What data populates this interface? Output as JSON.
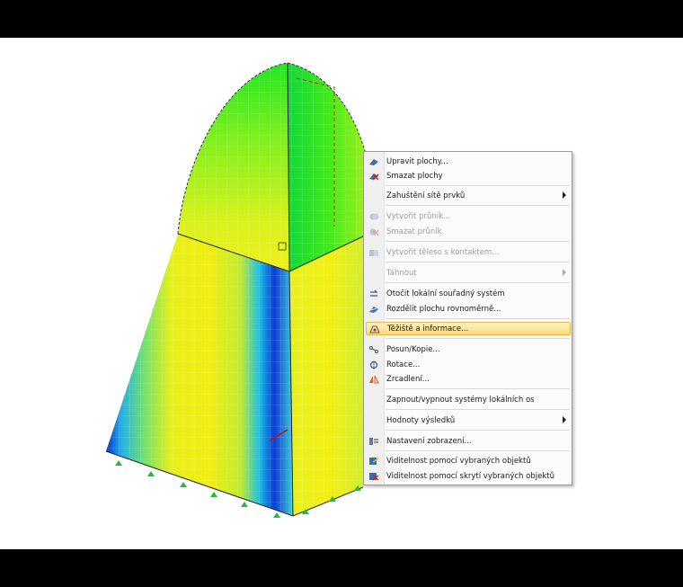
{
  "menu": {
    "items": [
      {
        "label": "Upravit plochy...",
        "icon": "edit-surface-icon"
      },
      {
        "label": "Smazat plochy",
        "icon": "delete-surface-icon"
      },
      {
        "label": "Zahuštění sítě prvků",
        "icon": "",
        "submenu": true
      },
      {
        "label": "Vytvořit průnik...",
        "icon": "intersection-icon",
        "disabled": true
      },
      {
        "label": "Smazat průnik",
        "icon": "delete-intersection-icon",
        "disabled": true
      },
      {
        "label": "Vytvořit těleso s kontaktem...",
        "icon": "solid-contact-icon",
        "disabled": true
      },
      {
        "label": "Táhnout",
        "icon": "",
        "submenu": true,
        "disabled": true
      },
      {
        "label": "Otočit lokální souřadný systém",
        "icon": "rotate-axes-icon"
      },
      {
        "label": "Rozdělit plochu rovnoměrně...",
        "icon": "divide-surface-icon"
      },
      {
        "label": "Těžiště a informace...",
        "icon": "centroid-icon",
        "highlighted": true
      },
      {
        "label": "Posun/Kopie...",
        "icon": "move-copy-icon"
      },
      {
        "label": "Rotace...",
        "icon": "rotate-icon"
      },
      {
        "label": "Zrcadlení...",
        "icon": "mirror-icon"
      },
      {
        "label": "Zapnout/vypnout systémy lokálních os",
        "icon": ""
      },
      {
        "label": "Hodnoty výsledků",
        "icon": "",
        "submenu": true
      },
      {
        "label": "Nastavení zobrazení...",
        "icon": "display-settings-icon"
      },
      {
        "label": "Viditelnost pomocí vybraných objektů",
        "icon": "visibility-selected-icon"
      },
      {
        "label": "Viditelnost pomocí skrytí vybraných objektů",
        "icon": "visibility-hide-icon"
      }
    ]
  },
  "colors": {
    "highlight": "#fcd87a",
    "result_high": "#f5f000",
    "result_mid": "#28e828",
    "result_low": "#0a2fd0",
    "support": "#1fbf3a"
  }
}
